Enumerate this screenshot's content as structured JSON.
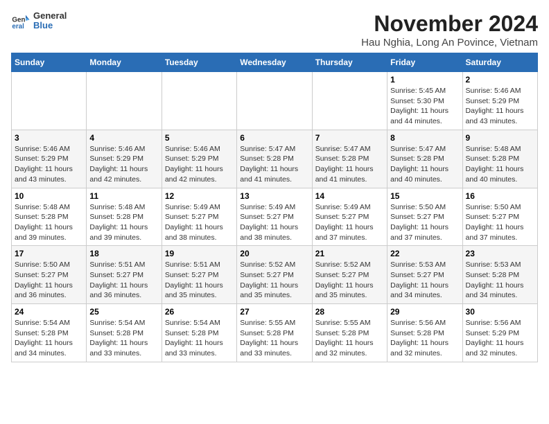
{
  "header": {
    "logo_general": "General",
    "logo_blue": "Blue",
    "title": "November 2024",
    "subtitle": "Hau Nghia, Long An Povince, Vietnam"
  },
  "weekdays": [
    "Sunday",
    "Monday",
    "Tuesday",
    "Wednesday",
    "Thursday",
    "Friday",
    "Saturday"
  ],
  "weeks": [
    [
      {
        "day": "",
        "info": ""
      },
      {
        "day": "",
        "info": ""
      },
      {
        "day": "",
        "info": ""
      },
      {
        "day": "",
        "info": ""
      },
      {
        "day": "",
        "info": ""
      },
      {
        "day": "1",
        "info": "Sunrise: 5:45 AM\nSunset: 5:30 PM\nDaylight: 11 hours and 44 minutes."
      },
      {
        "day": "2",
        "info": "Sunrise: 5:46 AM\nSunset: 5:29 PM\nDaylight: 11 hours and 43 minutes."
      }
    ],
    [
      {
        "day": "3",
        "info": "Sunrise: 5:46 AM\nSunset: 5:29 PM\nDaylight: 11 hours and 43 minutes."
      },
      {
        "day": "4",
        "info": "Sunrise: 5:46 AM\nSunset: 5:29 PM\nDaylight: 11 hours and 42 minutes."
      },
      {
        "day": "5",
        "info": "Sunrise: 5:46 AM\nSunset: 5:29 PM\nDaylight: 11 hours and 42 minutes."
      },
      {
        "day": "6",
        "info": "Sunrise: 5:47 AM\nSunset: 5:28 PM\nDaylight: 11 hours and 41 minutes."
      },
      {
        "day": "7",
        "info": "Sunrise: 5:47 AM\nSunset: 5:28 PM\nDaylight: 11 hours and 41 minutes."
      },
      {
        "day": "8",
        "info": "Sunrise: 5:47 AM\nSunset: 5:28 PM\nDaylight: 11 hours and 40 minutes."
      },
      {
        "day": "9",
        "info": "Sunrise: 5:48 AM\nSunset: 5:28 PM\nDaylight: 11 hours and 40 minutes."
      }
    ],
    [
      {
        "day": "10",
        "info": "Sunrise: 5:48 AM\nSunset: 5:28 PM\nDaylight: 11 hours and 39 minutes."
      },
      {
        "day": "11",
        "info": "Sunrise: 5:48 AM\nSunset: 5:28 PM\nDaylight: 11 hours and 39 minutes."
      },
      {
        "day": "12",
        "info": "Sunrise: 5:49 AM\nSunset: 5:27 PM\nDaylight: 11 hours and 38 minutes."
      },
      {
        "day": "13",
        "info": "Sunrise: 5:49 AM\nSunset: 5:27 PM\nDaylight: 11 hours and 38 minutes."
      },
      {
        "day": "14",
        "info": "Sunrise: 5:49 AM\nSunset: 5:27 PM\nDaylight: 11 hours and 37 minutes."
      },
      {
        "day": "15",
        "info": "Sunrise: 5:50 AM\nSunset: 5:27 PM\nDaylight: 11 hours and 37 minutes."
      },
      {
        "day": "16",
        "info": "Sunrise: 5:50 AM\nSunset: 5:27 PM\nDaylight: 11 hours and 37 minutes."
      }
    ],
    [
      {
        "day": "17",
        "info": "Sunrise: 5:50 AM\nSunset: 5:27 PM\nDaylight: 11 hours and 36 minutes."
      },
      {
        "day": "18",
        "info": "Sunrise: 5:51 AM\nSunset: 5:27 PM\nDaylight: 11 hours and 36 minutes."
      },
      {
        "day": "19",
        "info": "Sunrise: 5:51 AM\nSunset: 5:27 PM\nDaylight: 11 hours and 35 minutes."
      },
      {
        "day": "20",
        "info": "Sunrise: 5:52 AM\nSunset: 5:27 PM\nDaylight: 11 hours and 35 minutes."
      },
      {
        "day": "21",
        "info": "Sunrise: 5:52 AM\nSunset: 5:27 PM\nDaylight: 11 hours and 35 minutes."
      },
      {
        "day": "22",
        "info": "Sunrise: 5:53 AM\nSunset: 5:27 PM\nDaylight: 11 hours and 34 minutes."
      },
      {
        "day": "23",
        "info": "Sunrise: 5:53 AM\nSunset: 5:28 PM\nDaylight: 11 hours and 34 minutes."
      }
    ],
    [
      {
        "day": "24",
        "info": "Sunrise: 5:54 AM\nSunset: 5:28 PM\nDaylight: 11 hours and 34 minutes."
      },
      {
        "day": "25",
        "info": "Sunrise: 5:54 AM\nSunset: 5:28 PM\nDaylight: 11 hours and 33 minutes."
      },
      {
        "day": "26",
        "info": "Sunrise: 5:54 AM\nSunset: 5:28 PM\nDaylight: 11 hours and 33 minutes."
      },
      {
        "day": "27",
        "info": "Sunrise: 5:55 AM\nSunset: 5:28 PM\nDaylight: 11 hours and 33 minutes."
      },
      {
        "day": "28",
        "info": "Sunrise: 5:55 AM\nSunset: 5:28 PM\nDaylight: 11 hours and 32 minutes."
      },
      {
        "day": "29",
        "info": "Sunrise: 5:56 AM\nSunset: 5:28 PM\nDaylight: 11 hours and 32 minutes."
      },
      {
        "day": "30",
        "info": "Sunrise: 5:56 AM\nSunset: 5:29 PM\nDaylight: 11 hours and 32 minutes."
      }
    ]
  ]
}
